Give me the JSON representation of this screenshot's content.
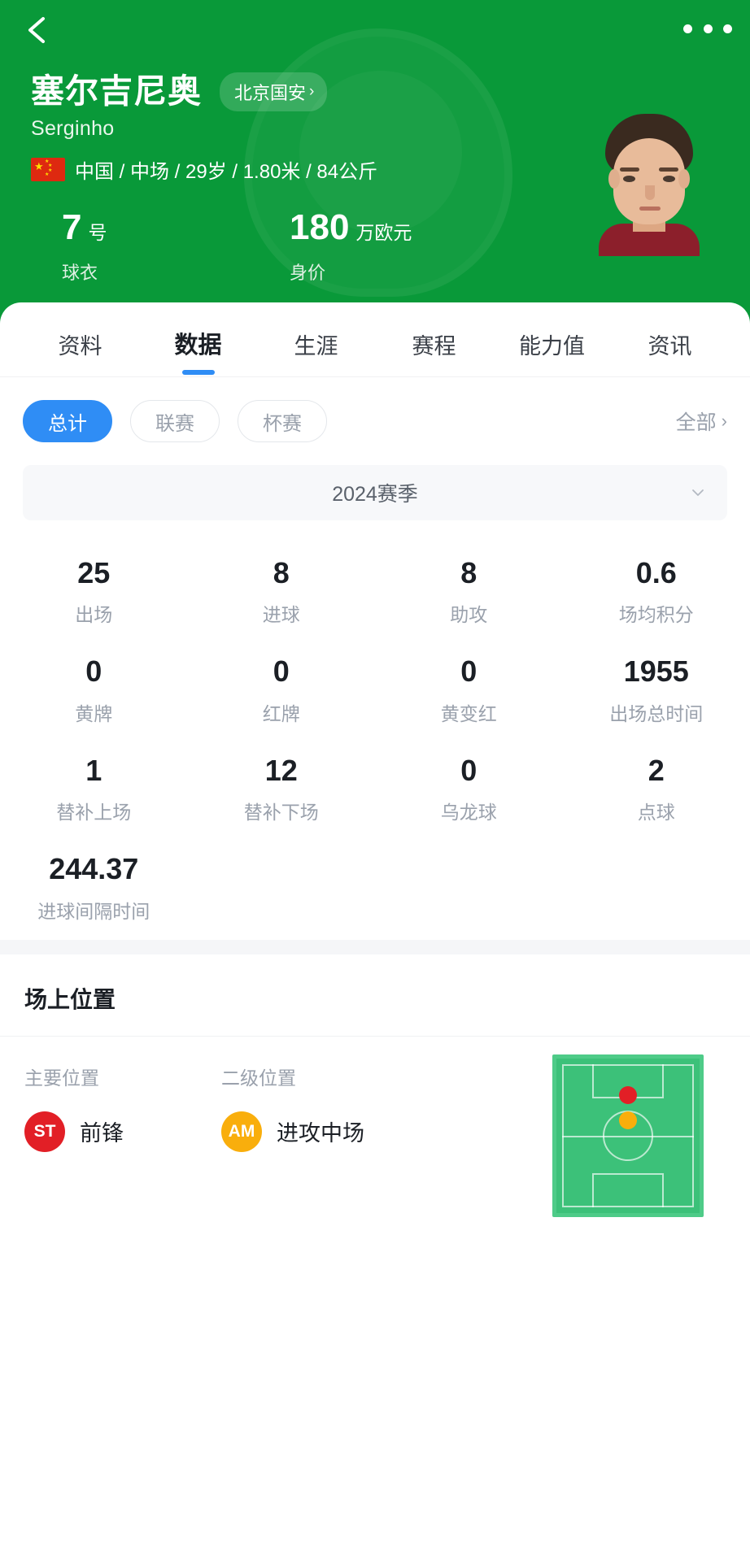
{
  "header": {
    "background_color": "#099939",
    "back_icon": "back-chevron-icon",
    "more_icon": "more-options-icon",
    "player_name_cn": "塞尔吉尼奥",
    "player_name_en": "Serginho",
    "team_chip": {
      "label": "北京国安",
      "chevron": "›"
    },
    "meta": {
      "flag": "china-flag-icon",
      "text": "中国 / 中场 / 29岁 / 1.80米 / 84公斤"
    },
    "kpis": [
      {
        "value": "7",
        "unit": "号",
        "label": "球衣"
      },
      {
        "value": "180",
        "unit": "万欧元",
        "label": "身价"
      }
    ],
    "photo": "player-portrait"
  },
  "tabs": [
    {
      "label": "资料",
      "active": false
    },
    {
      "label": "数据",
      "active": true
    },
    {
      "label": "生涯",
      "active": false
    },
    {
      "label": "赛程",
      "active": false
    },
    {
      "label": "能力值",
      "active": false
    },
    {
      "label": "资讯",
      "active": false
    }
  ],
  "tab_indicator_color": "#2f8df5",
  "filters": {
    "chips": [
      {
        "label": "总计",
        "active": true
      },
      {
        "label": "联赛",
        "active": false
      },
      {
        "label": "杯赛",
        "active": false
      }
    ],
    "all_link": {
      "label": "全部",
      "chevron": "›"
    }
  },
  "season_selector": {
    "label": "2024赛季",
    "caret": "chevron-down-icon"
  },
  "stats": [
    {
      "value": "25",
      "label": "出场"
    },
    {
      "value": "8",
      "label": "进球"
    },
    {
      "value": "8",
      "label": "助攻"
    },
    {
      "value": "0.6",
      "label": "场均积分"
    },
    {
      "value": "0",
      "label": "黄牌"
    },
    {
      "value": "0",
      "label": "红牌"
    },
    {
      "value": "0",
      "label": "黄变红"
    },
    {
      "value": "1955",
      "label": "出场总时间"
    },
    {
      "value": "1",
      "label": "替补上场"
    },
    {
      "value": "12",
      "label": "替补下场"
    },
    {
      "value": "0",
      "label": "乌龙球"
    },
    {
      "value": "2",
      "label": "点球"
    },
    {
      "value": "244.37",
      "label": "进球间隔时间"
    }
  ],
  "position_section": {
    "title": "场上位置",
    "primary": {
      "column_title": "主要位置",
      "code": "ST",
      "name": "前锋",
      "color": "#e21f26"
    },
    "secondary": {
      "column_title": "二级位置",
      "code": "AM",
      "name": "进攻中场",
      "color": "#f9ae0c"
    },
    "pitch": {
      "name": "football-pitch-diagram",
      "field_color": "#3cc179"
    }
  }
}
